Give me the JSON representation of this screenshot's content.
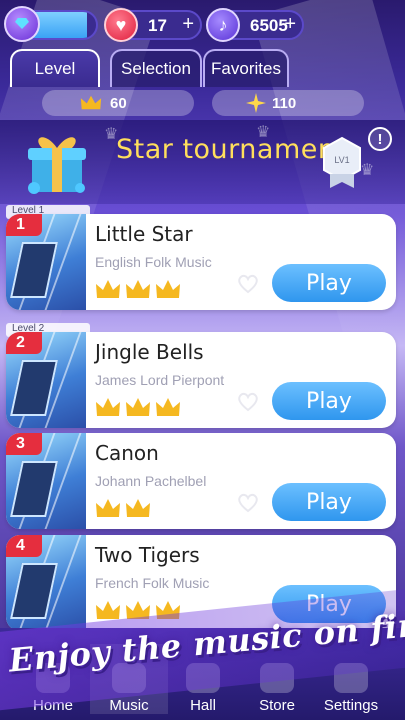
{
  "topbar": {
    "gem_progress": 0.9,
    "hearts": "17",
    "hearts_plus": "+",
    "notes": "6505",
    "notes_plus": "+"
  },
  "tabs": [
    {
      "label": "Level",
      "active": true
    },
    {
      "label": "Selection",
      "active": false
    },
    {
      "label": "Favorites",
      "active": false
    }
  ],
  "counts": {
    "crowns": "60",
    "stars": "110"
  },
  "tournament": {
    "title": "Star tournament",
    "badge": "LV1",
    "info": "!"
  },
  "songs": [
    {
      "rank": "1",
      "tag": "Level   1",
      "title": "Little Star",
      "artist": "English Folk Music",
      "crowns": 3,
      "play": "Play"
    },
    {
      "rank": "2",
      "tag": "Level   2",
      "title": "Jingle Bells",
      "artist": "James Lord Pierpont",
      "crowns": 3,
      "play": "Play"
    },
    {
      "rank": "3",
      "tag": "",
      "title": "Canon",
      "artist": "Johann Pachelbel",
      "crowns": 2,
      "play": "Play"
    },
    {
      "rank": "4",
      "tag": "",
      "title": "Two Tigers",
      "artist": "French Folk Music",
      "crowns": 3,
      "play": "Play"
    }
  ],
  "nav": {
    "home": "Home",
    "music": "Music",
    "hall": "Hall",
    "store": "Store",
    "settings": "Settings"
  },
  "promo": {
    "text": "Enjoy the music on fingers"
  },
  "colors": {
    "accent": "#2f96ee",
    "title": "#ffdf5c",
    "rank": "#e52e3e",
    "crown": "#f5b820"
  }
}
